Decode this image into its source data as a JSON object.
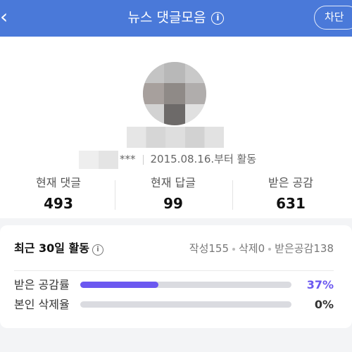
{
  "header": {
    "title": "뉴스 댓글모음",
    "info_icon": "info-icon",
    "back_icon": "chevron-left-icon",
    "block_label": "차단"
  },
  "profile": {
    "masked_suffix": "***",
    "since": "2015.08.16.부터 활동"
  },
  "stats": [
    {
      "label": "현재 댓글",
      "value": "493"
    },
    {
      "label": "현재 답글",
      "value": "99"
    },
    {
      "label": "받은 공감",
      "value": "631"
    }
  ],
  "recent": {
    "title": "최근 30일 활동",
    "summary": {
      "written": "작성155",
      "deleted": "삭제0",
      "likes": "받은공감138"
    },
    "rates": [
      {
        "label": "받은 공감률",
        "value": "37%",
        "fraction": 0.37
      },
      {
        "label": "본인 삭제율",
        "value": "0%",
        "fraction": 0.0
      }
    ]
  },
  "colors": {
    "header_bg": "#4a79d9",
    "accent": "#6b58f0",
    "track": "#dadbe0"
  }
}
